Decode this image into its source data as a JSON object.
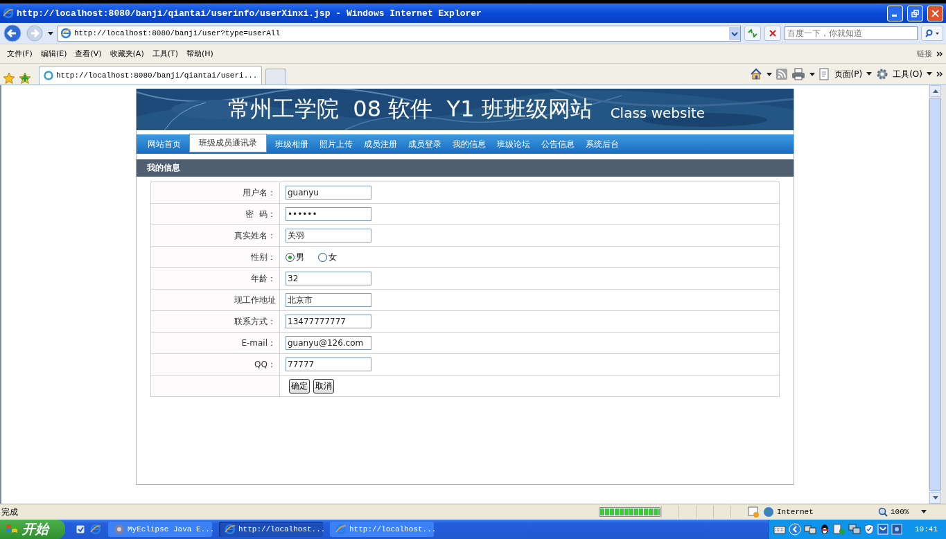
{
  "window": {
    "title": "http://localhost:8080/banji/qiantai/userinfo/userXinxi.jsp - Windows Internet Explorer"
  },
  "address_bar": {
    "url": "http://localhost:8080/banji/user?type=userAll"
  },
  "search": {
    "placeholder": "百度一下，你就知道"
  },
  "menu": [
    "文件(F)",
    "编辑(E)",
    "查看(V)",
    "收藏夹(A)",
    "工具(T)",
    "帮助(H)"
  ],
  "links_label": "链接",
  "tabs": [
    {
      "label": "http://localhost:8080/banji/qiantai/useri...",
      "selected": true
    }
  ],
  "command_bar": [
    "页面(P)",
    "工具(O)"
  ],
  "site": {
    "title": "常州工学院  08 软件  Y1 班班级网站",
    "subtitle": "Class website",
    "nav": [
      {
        "label": "网站首页",
        "selected": false
      },
      {
        "label": "班级成员通讯录",
        "selected": true
      },
      {
        "label": "班级相册",
        "selected": false
      },
      {
        "label": "照片上传",
        "selected": false
      },
      {
        "label": "成员注册",
        "selected": false
      },
      {
        "label": "成员登录",
        "selected": false
      },
      {
        "label": "我的信息",
        "selected": false
      },
      {
        "label": "班级论坛",
        "selected": false
      },
      {
        "label": "公告信息",
        "selected": false
      },
      {
        "label": "系统后台",
        "selected": false
      }
    ],
    "section_title": "我的信息",
    "form": [
      {
        "kind": "text",
        "label": "用户名：",
        "value": "guanyu"
      },
      {
        "kind": "text",
        "label": "密  码：",
        "value": "••••••"
      },
      {
        "kind": "text",
        "label": "真实姓名：",
        "value": "关羽"
      },
      {
        "kind": "radio",
        "label": "性别：",
        "options": [
          {
            "label": "男",
            "selected": true
          },
          {
            "label": "女",
            "selected": false
          }
        ]
      },
      {
        "kind": "text",
        "label": "年龄：",
        "value": "32"
      },
      {
        "kind": "text",
        "label": "现工作地址",
        "value": "北京市"
      },
      {
        "kind": "text",
        "label": "联系方式：",
        "value": "13477777777"
      },
      {
        "kind": "text",
        "label": "E-mail：",
        "value": "guanyu@126.com"
      },
      {
        "kind": "text",
        "label": "QQ：",
        "value": "77777"
      },
      {
        "kind": "buttons",
        "buttons": [
          "确定",
          "取消"
        ]
      }
    ]
  },
  "status_bar": {
    "text": "完成",
    "progress": {
      "level": 1
    },
    "zone": "Internet",
    "zoom": "100%"
  },
  "taskbar": {
    "start": "开始",
    "items": [
      {
        "label": "MyEclipse Java E...",
        "selected": false
      },
      {
        "label": "http://localhost...",
        "selected": true
      },
      {
        "label": "http://localhost...",
        "selected": false
      }
    ],
    "clock": "10:41"
  }
}
